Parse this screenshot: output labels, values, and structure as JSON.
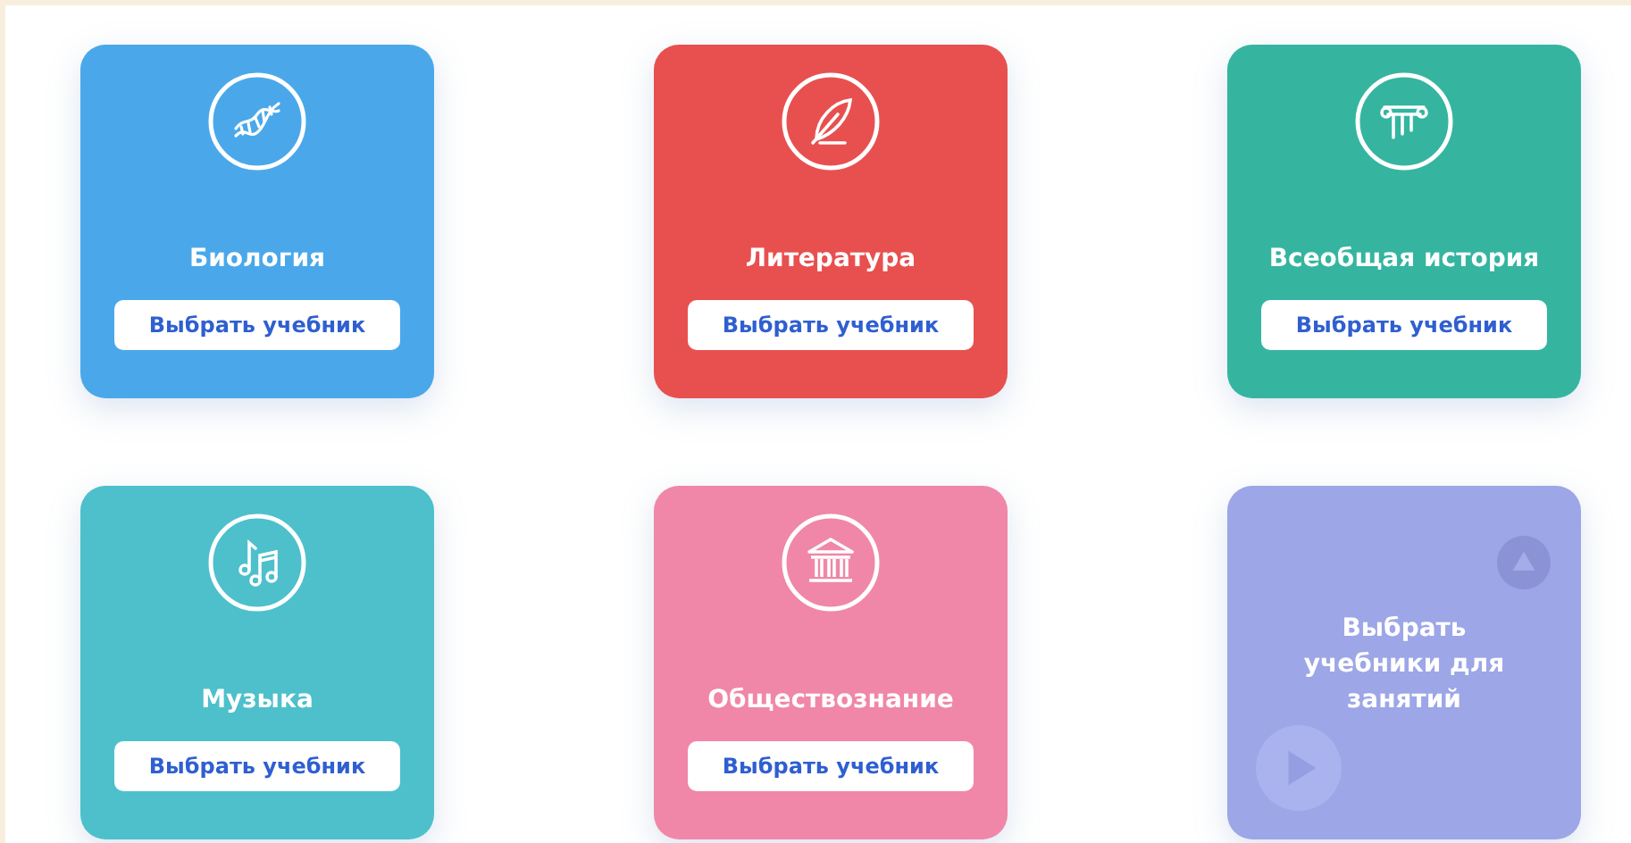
{
  "cards": [
    {
      "kind": "subject",
      "title": "Биология",
      "button": "Выбрать учебник",
      "color": "#4aa8ea"
    },
    {
      "kind": "subject",
      "title": "Литература",
      "button": "Выбрать учебник",
      "color": "#e8504f"
    },
    {
      "kind": "subject",
      "title": "Всеобщая история",
      "button": "Выбрать учебник",
      "color": "#35b5a0"
    },
    {
      "kind": "subject",
      "title": "Музыка",
      "button": "Выбрать учебник",
      "color": "#4dc0cc"
    },
    {
      "kind": "subject",
      "title": "Обществознание",
      "button": "Выбрать учебник",
      "color": "#f087a8"
    },
    {
      "kind": "action",
      "title": "Выбрать учебники для занятий",
      "color": "#9da6e6"
    }
  ]
}
